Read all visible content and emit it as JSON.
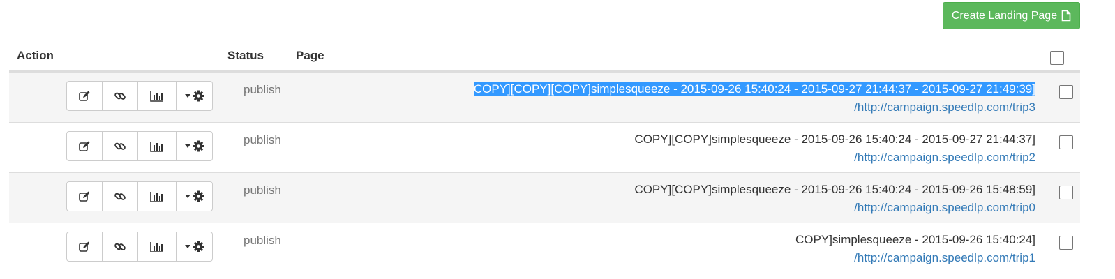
{
  "toolbar": {
    "create_label": "Create Landing Page",
    "create_icon": "file-icon",
    "create_color": "#5cb85c"
  },
  "table": {
    "headers": {
      "action": "Action",
      "status": "Status",
      "page": "Page"
    },
    "rows": [
      {
        "status": "publish",
        "title": "COPY][COPY][COPY]simplesqueeze - 2015-09-26 15:40:24 - 2015-09-27 21:44:37 - 2015-09-27 21:49:39]",
        "url": "/http://campaign.speedlp.com/trip3",
        "selected": true
      },
      {
        "status": "publish",
        "title": "COPY][COPY]simplesqueeze - 2015-09-26 15:40:24 - 2015-09-27 21:44:37]",
        "url": "/http://campaign.speedlp.com/trip2",
        "selected": false
      },
      {
        "status": "publish",
        "title": "COPY][COPY]simplesqueeze - 2015-09-26 15:40:24 - 2015-09-26 15:48:59]",
        "url": "/http://campaign.speedlp.com/trip0",
        "selected": false
      },
      {
        "status": "publish",
        "title": "COPY]simplesqueeze - 2015-09-26 15:40:24]",
        "url": "/http://campaign.speedlp.com/trip1",
        "selected": false
      }
    ]
  },
  "icons": {
    "edit": "edit-icon",
    "link": "link-icon",
    "stats": "bar-chart-icon",
    "settings": "gear-icon",
    "caret": "caret-down-icon"
  },
  "colors": {
    "link": "#337ab7",
    "selection": "#3399ff",
    "stripe": "#f5f5f5"
  }
}
